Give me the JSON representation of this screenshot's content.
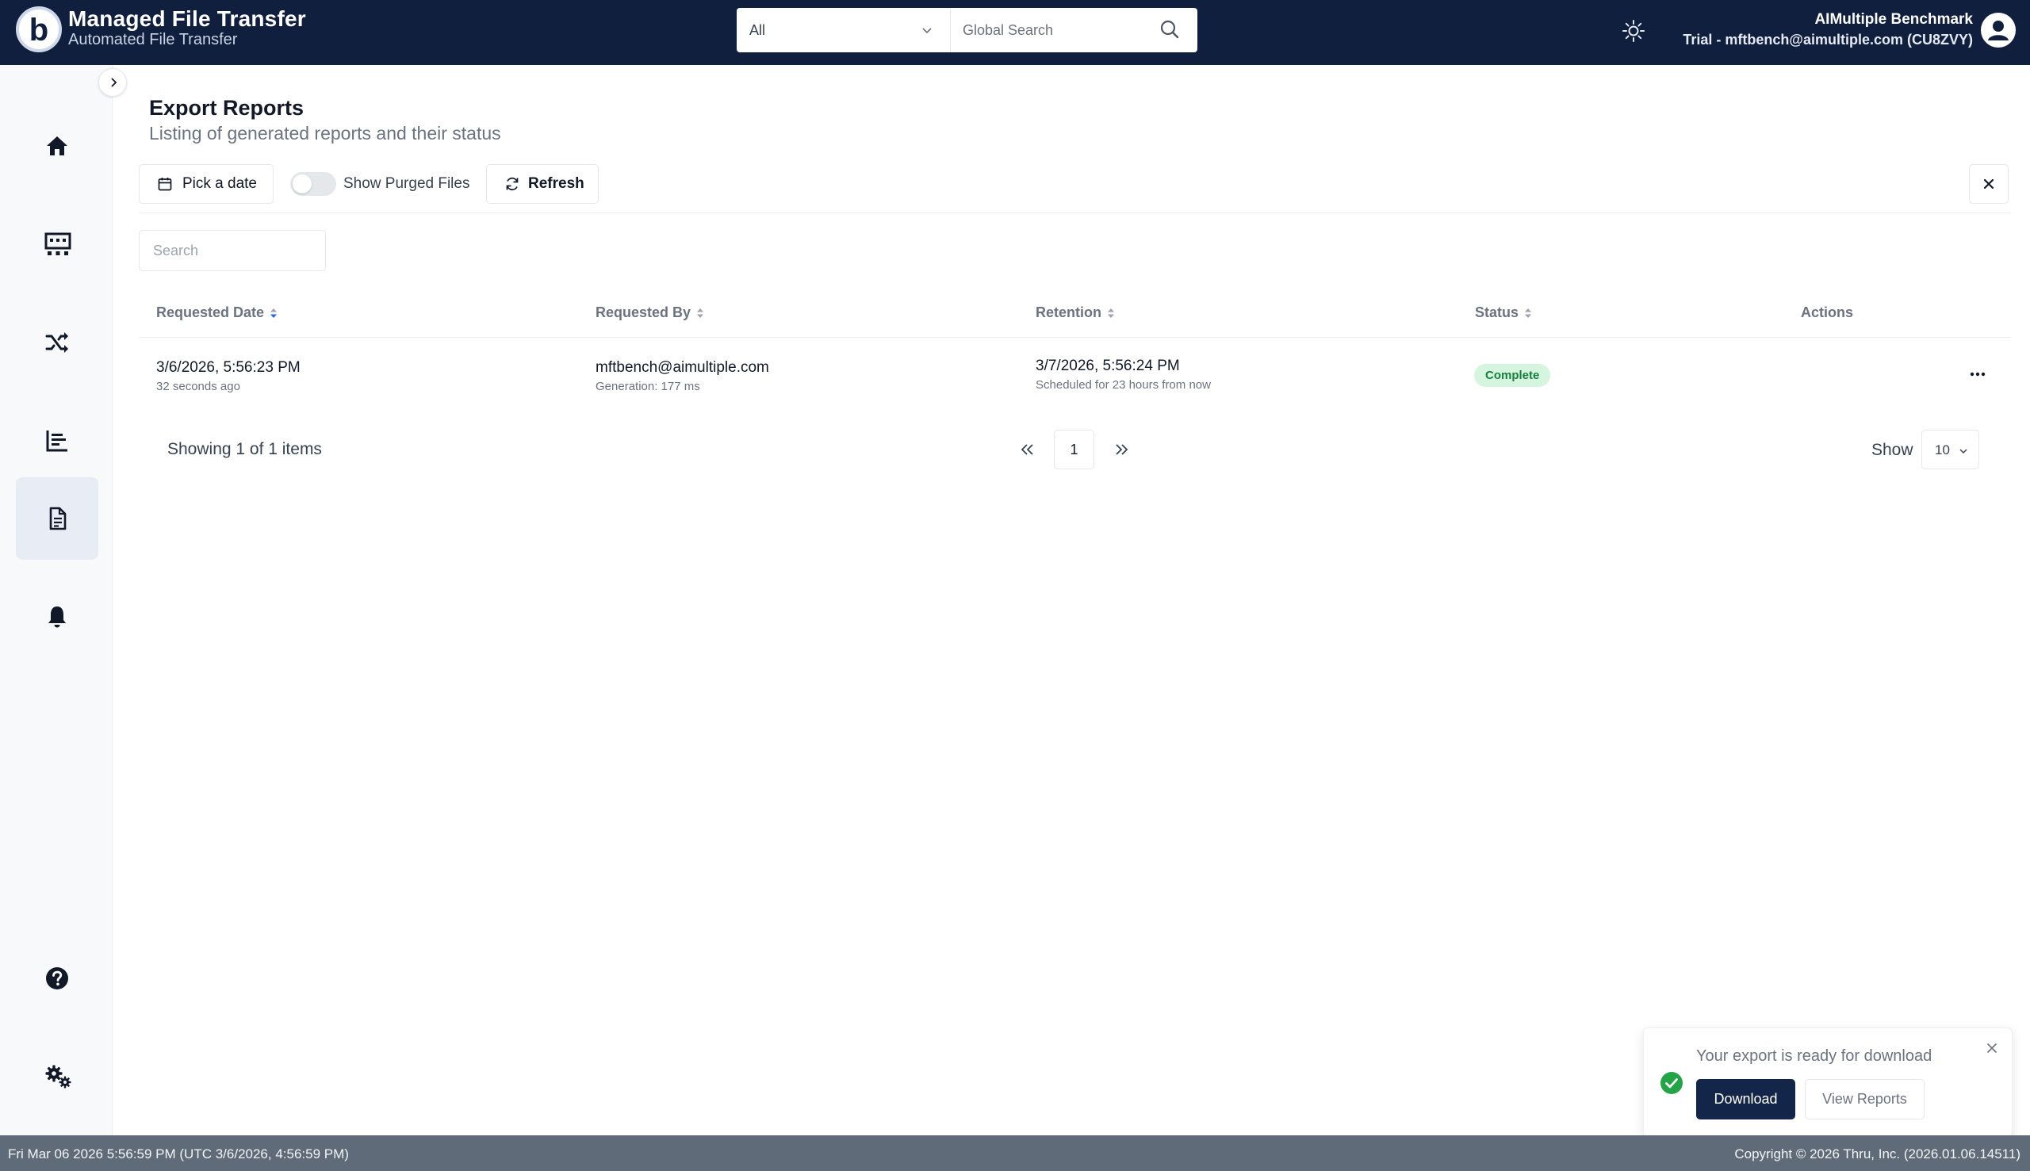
{
  "app": {
    "title": "Managed File Transfer",
    "subtitle": "Automated File Transfer"
  },
  "global_search": {
    "scope": "All",
    "placeholder": "Global Search"
  },
  "account": {
    "name": "AIMultiple Benchmark",
    "email_line": "Trial - mftbench@aimultiple.com (CU8ZVY)"
  },
  "icons": {
    "logo": "brand-b-logo",
    "theme": "sun-icon",
    "avatar": "user-icon",
    "sidebar": [
      "home-icon",
      "dashboard-icon",
      "shuffle-icon",
      "bar-chart-icon",
      "document-icon",
      "bell-icon",
      "help-icon",
      "settings-icon"
    ]
  },
  "page": {
    "title": "Export Reports",
    "subtitle": "Listing of generated reports and their status"
  },
  "toolbar": {
    "date_label": "Pick a date",
    "purged_label": "Show Purged Files",
    "purged_on": false,
    "refresh_label": "Refresh"
  },
  "table": {
    "search_placeholder": "Search",
    "columns": [
      "Requested Date",
      "Requested By",
      "Retention",
      "Status",
      "Actions"
    ],
    "rows": [
      {
        "date": "3/6/2026, 5:56:23 PM",
        "date_ago": "32 seconds ago",
        "by": "mftbench@aimultiple.com",
        "generation": "Generation: 177 ms",
        "retention": "3/7/2026, 5:56:24 PM",
        "retention_note": "Scheduled for 23 hours from now",
        "status": "Complete"
      }
    ]
  },
  "pagination": {
    "showing": "Showing 1 of 1 items",
    "current_page": "1",
    "show_label": "Show",
    "page_size": "10"
  },
  "toast": {
    "message": "Your export is ready for download",
    "download_label": "Download",
    "view_label": "View Reports"
  },
  "footer": {
    "left": "Fri Mar 06 2026 5:56:59 PM (UTC 3/6/2026, 4:56:59 PM)",
    "right": "Copyright © 2026 Thru, Inc. (2026.01.06.14511)"
  },
  "colors": {
    "topbar": "#0f1f3d",
    "status_complete_bg": "#d6f5df",
    "status_complete_text": "#15803d",
    "primary_button": "#13264a",
    "footer": "#5f6b78"
  }
}
